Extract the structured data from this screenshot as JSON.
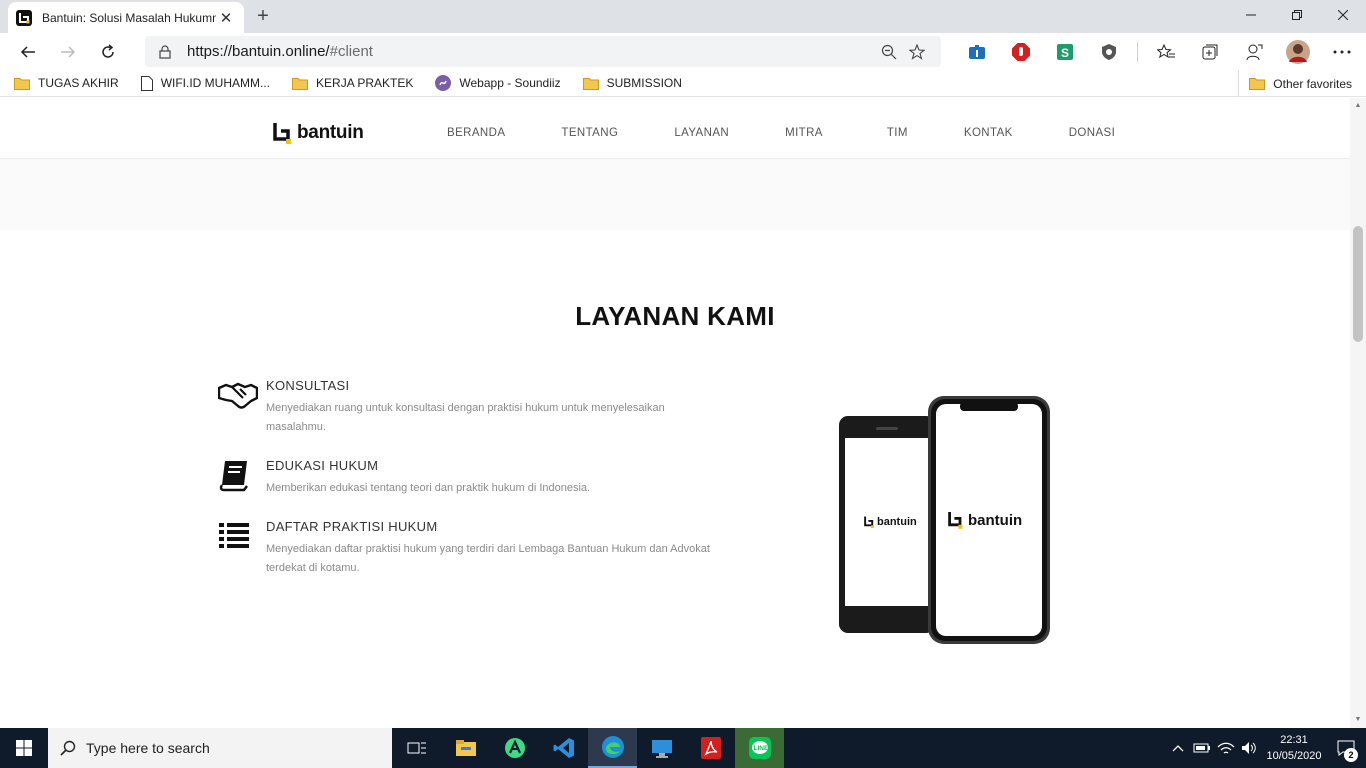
{
  "browser": {
    "tab_title": "Bantuin: Solusi Masalah Hukumm",
    "url_host": "https://bantuin.online/",
    "url_path": "#client",
    "favorites": [
      {
        "label": "TUGAS AKHIR",
        "icon": "folder-icon"
      },
      {
        "label": "WIFI.ID MUHAMM...",
        "icon": "page-icon"
      },
      {
        "label": "KERJA PRAKTEK",
        "icon": "folder-icon"
      },
      {
        "label": "Webapp - Soundiiz",
        "icon": "soundiiz-icon"
      },
      {
        "label": "SUBMISSION",
        "icon": "folder-icon"
      }
    ],
    "other_favorites": "Other favorites"
  },
  "site": {
    "brand": "bantuin",
    "nav": [
      "BERANDA",
      "TENTANG",
      "LAYANAN",
      "MITRA",
      "TIM",
      "KONTAK",
      "DONASI"
    ],
    "section_title": "LAYANAN KAMI",
    "services": [
      {
        "title": "KONSULTASI",
        "desc": "Menyediakan ruang untuk konsultasi dengan praktisi hukum untuk menyelesaikan masalahmu.",
        "icon": "handshake-icon"
      },
      {
        "title": "EDUKASI HUKUM",
        "desc": "Memberikan edukasi tentang teori dan praktik hukum di Indonesia.",
        "icon": "book-icon"
      },
      {
        "title": "DAFTAR PRAKTISI HUKUM",
        "desc": "Menyediakan daftar praktisi hukum yang terdiri dari Lembaga Bantuan Hukum dan Advokat terdekat di kotamu.",
        "icon": "list-icon"
      }
    ],
    "phone_brand_back": "bantuin",
    "phone_brand_front": "bantuin",
    "colors": {
      "logo_accent": "#f5c400",
      "text_dark": "#111111",
      "text_muted": "#8a8a8a"
    }
  },
  "taskbar": {
    "search_placeholder": "Type here to search",
    "time": "22:31",
    "date": "10/05/2020",
    "notifications": "2"
  }
}
